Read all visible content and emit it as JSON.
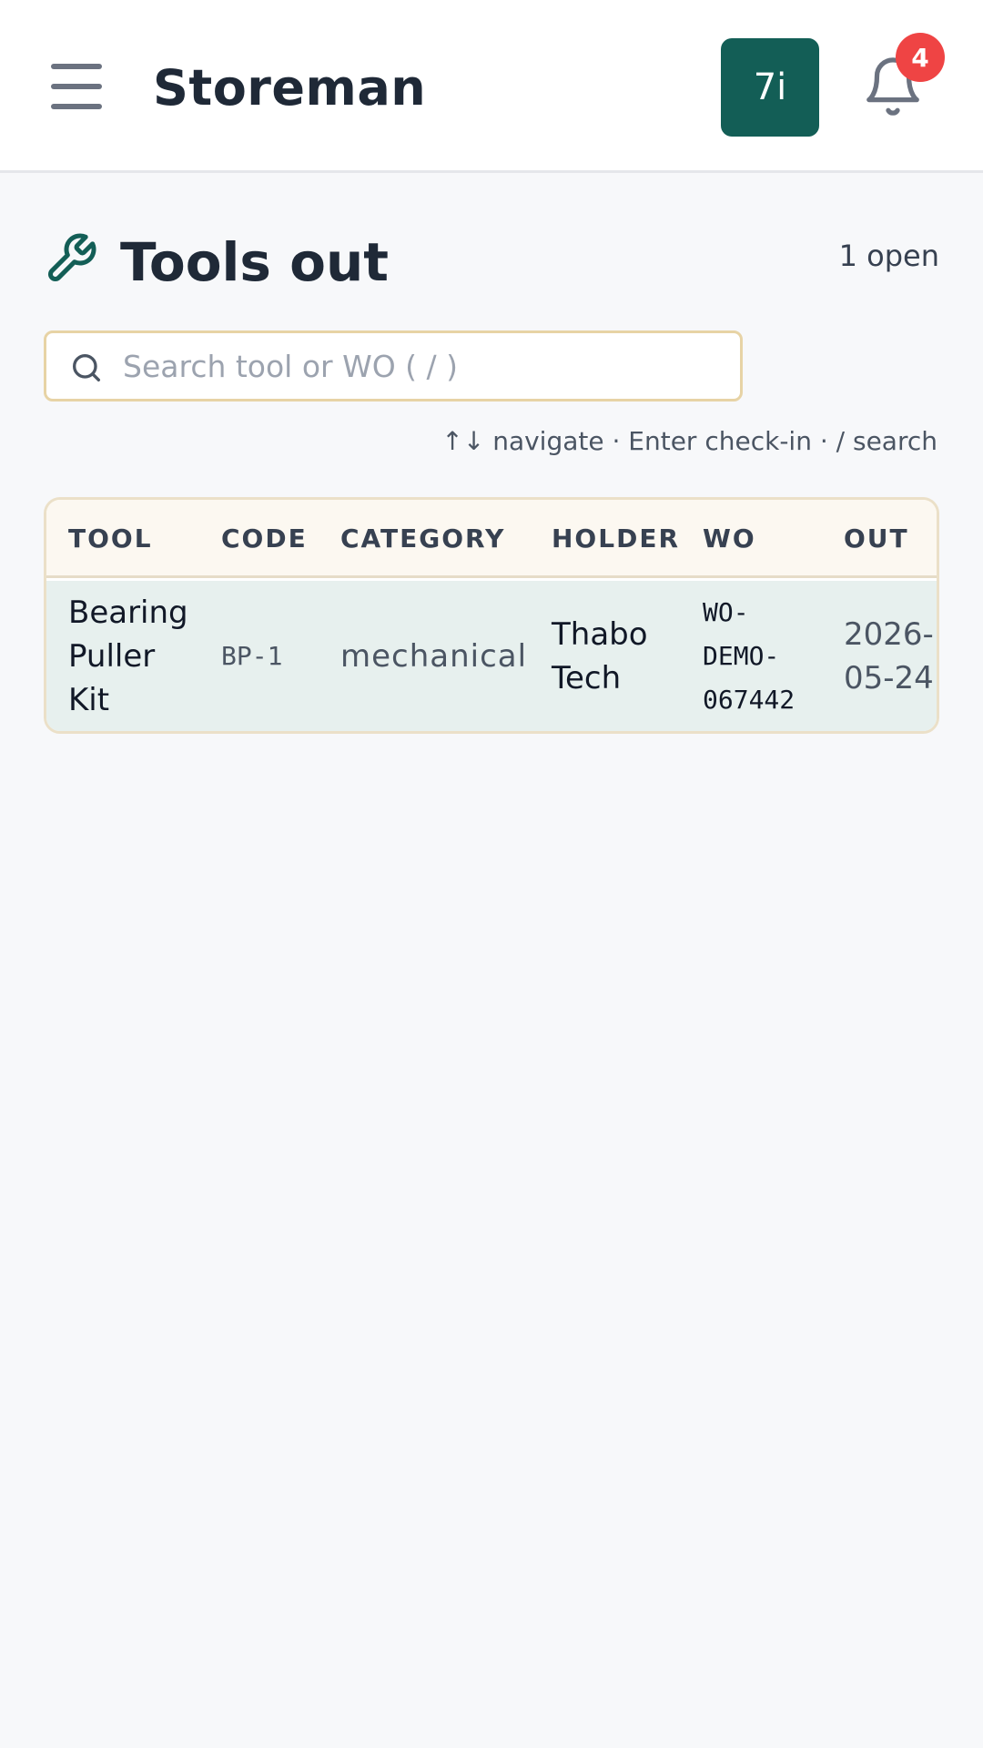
{
  "header": {
    "app_title": "Storeman",
    "avatar_text": "7i",
    "notification_count": "4",
    "colors": {
      "brand": "#135e56",
      "badge": "#ef4444"
    },
    "icons": [
      "menu-icon",
      "bell-icon"
    ]
  },
  "page": {
    "title": "Tools out",
    "icon": "wrench-icon",
    "open_count": "1 open"
  },
  "search": {
    "placeholder": "Search tool or WO ( / )",
    "value": ""
  },
  "hint": "↑↓ navigate · Enter check-in · / search",
  "table": {
    "columns": [
      "TOOL",
      "CODE",
      "CATEGORY",
      "HOLDER",
      "WO",
      "OUT"
    ],
    "rows": [
      {
        "tool_lines": [
          "Bearing",
          "Puller",
          "Kit"
        ],
        "code": "BP-1",
        "category": "mechanical",
        "holder_lines": [
          "Thabo",
          "Tech"
        ],
        "wo_lines": [
          "WO-",
          "DEMO-",
          "067442"
        ],
        "out_lines": [
          "2026-",
          "05-24"
        ]
      }
    ]
  }
}
